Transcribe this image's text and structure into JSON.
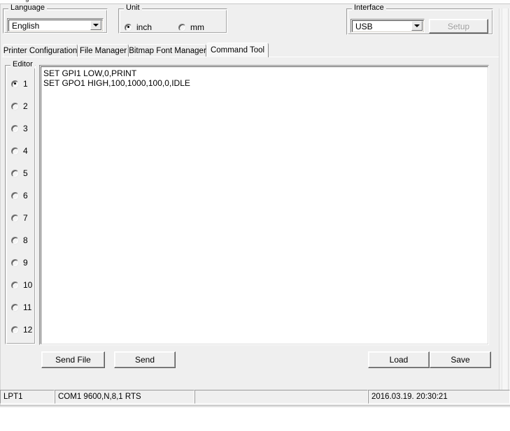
{
  "window": {
    "background_color": "#efefef"
  },
  "language_group": {
    "title": "Language",
    "selected": "English"
  },
  "unit_group": {
    "title": "Unit",
    "options": [
      {
        "label": "inch",
        "selected": true
      },
      {
        "label": "mm",
        "selected": false
      }
    ]
  },
  "interface_group": {
    "title": "Interface",
    "selected": "USB",
    "setup_button": {
      "label": "Setup",
      "disabled": true
    }
  },
  "tabs": [
    {
      "label": "Printer Configuration",
      "active": false
    },
    {
      "label": "File Manager",
      "active": false
    },
    {
      "label": "Bitmap Font Manager",
      "active": false
    },
    {
      "label": "Command Tool",
      "active": true
    }
  ],
  "editor_group": {
    "title": "Editor",
    "items": [
      {
        "label": "1",
        "selected": true
      },
      {
        "label": "2",
        "selected": false
      },
      {
        "label": "3",
        "selected": false
      },
      {
        "label": "4",
        "selected": false
      },
      {
        "label": "5",
        "selected": false
      },
      {
        "label": "6",
        "selected": false
      },
      {
        "label": "7",
        "selected": false
      },
      {
        "label": "8",
        "selected": false
      },
      {
        "label": "9",
        "selected": false
      },
      {
        "label": "10",
        "selected": false
      },
      {
        "label": "11",
        "selected": false
      },
      {
        "label": "12",
        "selected": false
      }
    ]
  },
  "command_editor": {
    "text": "SET GPI1 LOW,0,PRINT\nSET GPO1 HIGH,100,1000,100,0,IDLE"
  },
  "actions": {
    "send_file": "Send File",
    "send": "Send",
    "load": "Load",
    "save": "Save"
  },
  "statusbar": {
    "port": "LPT1",
    "serial": "COM1 9600,N,8,1 RTS",
    "spacer": "",
    "datetime": "2016.03.19. 20:30:21"
  }
}
